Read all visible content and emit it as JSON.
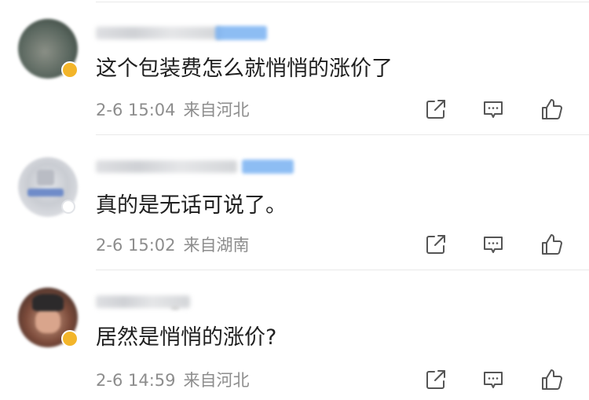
{
  "comments": [
    {
      "text": "这个包装费怎么就悄悄的涨价了",
      "time": "2-6 15:04",
      "location": "来自河北"
    },
    {
      "text": "真的是无话可说了。",
      "time": "2-6 15:02",
      "location": "来自湖南"
    },
    {
      "text": "居然是悄悄的涨价?",
      "time": "2-6 14:59",
      "location": "来自河北"
    }
  ],
  "icons": {
    "repost": "share-icon",
    "reply": "comment-icon",
    "like": "thumbs-up-icon"
  },
  "colors": {
    "text": "#1f1f1f",
    "meta": "#8d8d8d",
    "icon": "#555555",
    "vip_badge": "#f3b52a"
  }
}
